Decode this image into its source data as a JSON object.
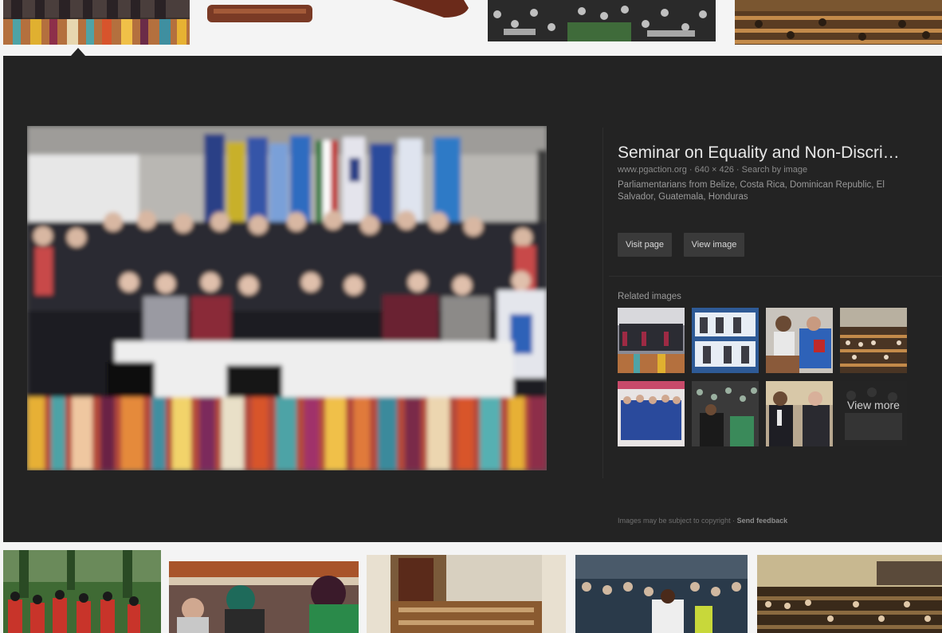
{
  "preview": {
    "title": "Seminar on Equality and Non-Discri…",
    "meta": "www.pgaction.org · 640 × 426 · Search by image",
    "description": "Parliamentarians from Belize, Costa Rica, Dominican Republic, El Salvador, Guatemala, Honduras",
    "visit_label": "Visit page",
    "view_label": "View image",
    "related_label": "Related images",
    "more_label": "View more",
    "footer_text": "Images may be subject to copyright",
    "footer_sep": " · ",
    "feedback_label": "Send feedback"
  },
  "colors": {
    "panel_background": "#232323",
    "page_background": "#f4f4f4",
    "button_background": "#3a3a3a"
  }
}
